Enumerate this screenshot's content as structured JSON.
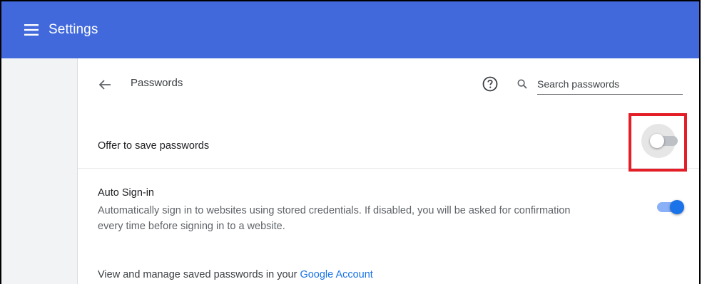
{
  "header": {
    "title": "Settings",
    "menu_icon": "hamburger-menu-icon"
  },
  "page": {
    "title": "Passwords",
    "back_icon": "back-arrow-icon",
    "help_icon": "help-circle-icon",
    "search": {
      "placeholder": "Search passwords",
      "value": "",
      "icon": "search-icon"
    }
  },
  "settings": {
    "offer_to_save": {
      "label": "Offer to save passwords",
      "enabled": false
    },
    "auto_signin": {
      "title": "Auto Sign-in",
      "description": "Automatically sign in to websites using stored credentials. If disabled, you will be asked for confirmation every time before signing in to a website.",
      "enabled": true
    },
    "manage": {
      "text": "View and manage saved passwords in your ",
      "link": "Google Account"
    }
  },
  "colors": {
    "topbar": "#4169dc",
    "accent": "#1a73e8",
    "highlight": "#e41e26"
  }
}
